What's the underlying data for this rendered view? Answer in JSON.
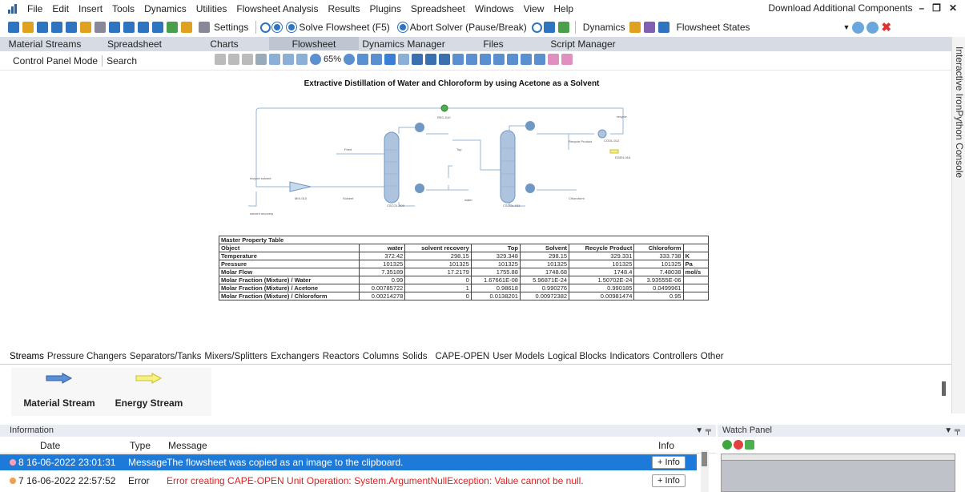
{
  "menu": {
    "items": [
      "File",
      "Edit",
      "Insert",
      "Tools",
      "Dynamics",
      "Utilities",
      "Flowsheet Analysis",
      "Results",
      "Plugins",
      "Spreadsheet",
      "Windows",
      "View",
      "Help"
    ],
    "download": "Download Additional Components"
  },
  "toolbar": {
    "settings": "Settings",
    "solve": "Solve Flowsheet (F5)",
    "abort": "Abort Solver (Pause/Break)",
    "dynamics": "Dynamics",
    "fs_states": "Flowsheet States"
  },
  "doc_tabs": [
    "Material Streams",
    "Spreadsheet",
    "Charts",
    "Flowsheet",
    "Dynamics Manager",
    "Files",
    "Script Manager"
  ],
  "control": {
    "mode": "Control Panel Mode",
    "search": "Search",
    "zoom": "65%"
  },
  "side_console": "Interactive IronPython Console",
  "flowsheet": {
    "title": "Extractive Distillation of Water and Chloroform by using Acetone as a Solvent",
    "labels": {
      "rec": "REC-010",
      "recycle": "recycle",
      "recycle_product": "Recycle Product",
      "cool": "COOL-012",
      "eden": "EDEN-016",
      "feed": "Feed",
      "top": "Top",
      "recycle_solvent": "recycle solvent",
      "mix": "MIX-010",
      "solvent": "Solvent",
      "water": "water",
      "col1": "CSCOL-009",
      "col2": "CSCOL-011",
      "chloroform": "Chloroform",
      "solvent_recovery": "solvent recovery"
    }
  },
  "property_table": {
    "title": "Master Property Table",
    "header": [
      "Object",
      "water",
      "solvent recovery",
      "Top",
      "Solvent",
      "Recycle Product",
      "Chloroform",
      ""
    ],
    "rows": [
      [
        "Temperature",
        "372.42",
        "298.15",
        "329.348",
        "298.15",
        "329.331",
        "333.738",
        "K"
      ],
      [
        "Pressure",
        "101325",
        "101325",
        "101325",
        "101325",
        "101325",
        "101325",
        "Pa"
      ],
      [
        "Molar Flow",
        "7.35189",
        "17.2179",
        "1755.88",
        "1748.68",
        "1748.4",
        "7.48038",
        "mol/s"
      ],
      [
        "Molar Fraction (Mixture) / Water",
        "0.99",
        "0",
        "1.67661E-08",
        "5.96871E-24",
        "1.50702E-24",
        "3.93555E-06",
        ""
      ],
      [
        "Molar Fraction (Mixture) / Acetone",
        "0.00785722",
        "1",
        "0.98618",
        "0.990276",
        "0.990185",
        "0.0499961",
        ""
      ],
      [
        "Molar Fraction (Mixture) / Chloroform",
        "0.00214278",
        "0",
        "0.0138201",
        "0.00972382",
        "0.00981474",
        "0.95",
        ""
      ]
    ]
  },
  "palette": {
    "tabs": [
      "Streams",
      "Pressure Changers",
      "Separators/Tanks",
      "Mixers/Splitters",
      "Exchangers",
      "Reactors",
      "Columns",
      "Solids",
      "CAPE-OPEN",
      "User Models",
      "Logical Blocks",
      "Indicators",
      "Controllers",
      "Other"
    ],
    "items": [
      "Material Stream",
      "Energy Stream"
    ]
  },
  "info": {
    "title": "Information",
    "columns": [
      "Date",
      "Type",
      "Message",
      "Info"
    ],
    "rows": [
      {
        "num": "8",
        "date": "16-06-2022 23:01:31",
        "type": "Message",
        "message": "The flowsheet was copied as an image to the clipboard.",
        "btn": "+ Info"
      },
      {
        "num": "7",
        "date": "16-06-2022 22:57:52",
        "type": "Error",
        "message": "Error creating CAPE-OPEN Unit Operation: System.ArgumentNullException: Value cannot be null.",
        "btn": "+ Info"
      }
    ]
  },
  "watch": {
    "title": "Watch Panel"
  },
  "colors": {
    "selected_row": "#1e7ad8",
    "error_text": "#e02020",
    "stream_line": "#9ab7d6",
    "unit_blue": "#6f98c4"
  }
}
